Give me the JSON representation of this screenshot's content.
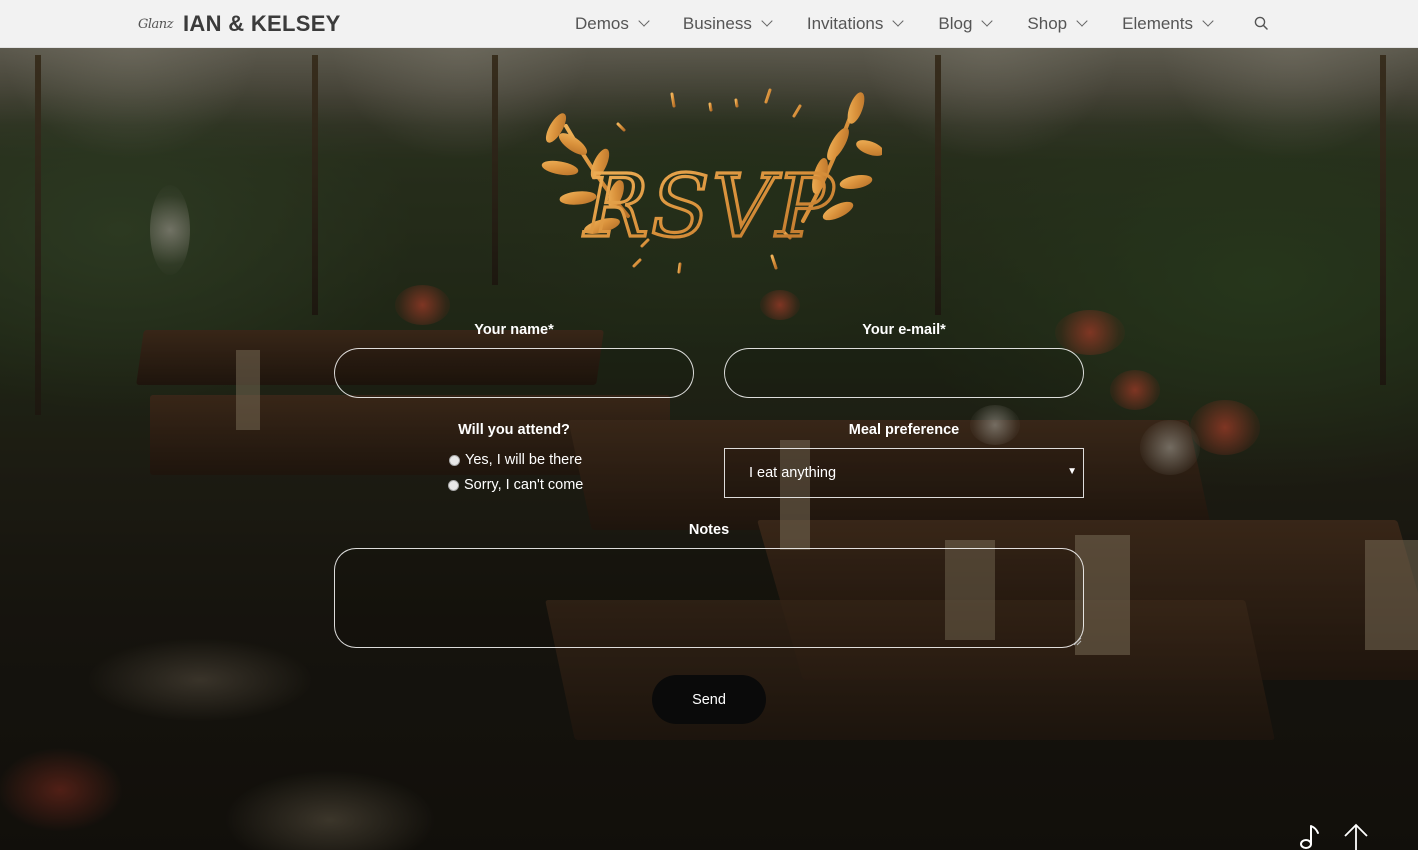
{
  "header": {
    "logo_script": "Glanz",
    "logo_name": "IAN & KELSEY",
    "nav": [
      {
        "label": "Demos"
      },
      {
        "label": "Business"
      },
      {
        "label": "Invitations"
      },
      {
        "label": "Blog"
      },
      {
        "label": "Shop"
      },
      {
        "label": "Elements"
      }
    ],
    "search_icon": "search-icon"
  },
  "emblem": {
    "text": "RSVP",
    "color": "#d9913b"
  },
  "form": {
    "name_label": "Your name*",
    "name_value": "",
    "email_label": "Your e-mail*",
    "email_value": "",
    "attend_label": "Will you attend?",
    "attend_options": [
      "Yes, I will be there",
      "Sorry, I can't come"
    ],
    "meal_label": "Meal preference",
    "meal_value": "I eat anything",
    "notes_label": "Notes",
    "notes_value": "",
    "send_label": "Send"
  },
  "floating": {
    "music_icon": "music-note-icon",
    "top_icon": "arrow-up-icon"
  },
  "colors": {
    "header_bg": "#f2f2f2",
    "nav_text": "#555555",
    "button_bg": "#0a0a0a",
    "form_text": "#ffffff"
  }
}
